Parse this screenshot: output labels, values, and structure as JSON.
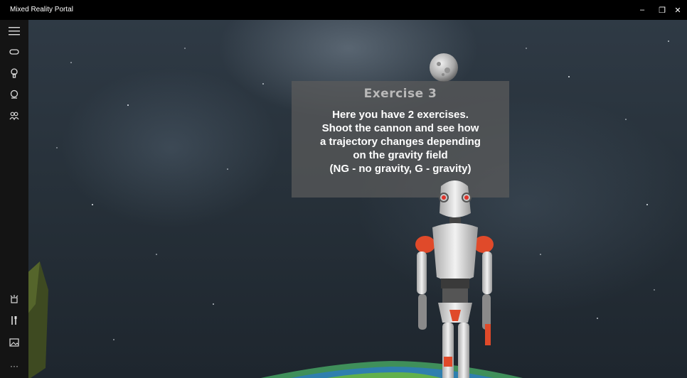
{
  "window": {
    "title": "Mixed Reality Portal",
    "controls": {
      "minimize": "–",
      "maximize": "❐",
      "close": "✕"
    }
  },
  "sidebar": {
    "items": [
      {
        "icon": "hamburger-menu-icon"
      },
      {
        "icon": "headset-icon"
      },
      {
        "icon": "motion-controller-icon"
      },
      {
        "icon": "controller-icon"
      },
      {
        "icon": "people-icon"
      }
    ],
    "bottom_items": [
      {
        "icon": "headset-setup-icon"
      },
      {
        "icon": "tools-icon"
      },
      {
        "icon": "photos-icon"
      },
      {
        "icon": "more-icon",
        "glyph": "···"
      }
    ]
  },
  "scene": {
    "panel": {
      "title": "Exercise 3",
      "text": "Here you have 2 exercises.\nShoot the cannon and see how\na trajectory changes depending\non the gravity field\n(NG - no gravity, G - gravity)"
    }
  },
  "colors": {
    "titlebar": "#000000",
    "sidebar": "#141414",
    "panel_title": "#b9b9b9",
    "robot_accent": "#e04a2a"
  }
}
